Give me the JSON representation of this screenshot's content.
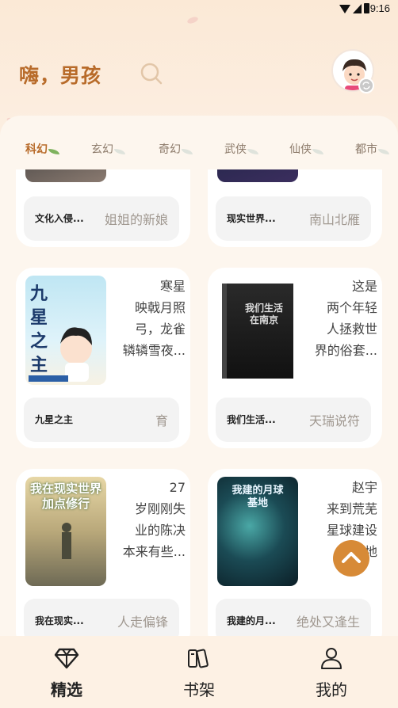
{
  "status": {
    "time": "9:16"
  },
  "header": {
    "greeting": "嗨，男孩"
  },
  "tabs": [
    {
      "label": "科幻",
      "active": true
    },
    {
      "label": "玄幻",
      "active": false
    },
    {
      "label": "奇幻",
      "active": false
    },
    {
      "label": "武侠",
      "active": false
    },
    {
      "label": "仙侠",
      "active": false
    },
    {
      "label": "都市",
      "active": false
    }
  ],
  "books": [
    {
      "title": "文化入侵...",
      "author": "姐姐的新娘",
      "desc": ""
    },
    {
      "title": "现实世界...",
      "author": "南山北雁",
      "desc": ""
    },
    {
      "title": "九星之主",
      "author": "育",
      "desc": "寒星\n映戟月照\n弓，龙雀\n辚辚雪夜...",
      "cover_text": "九星之主"
    },
    {
      "title": "我们生活...",
      "author": "天瑞说符",
      "desc": "这是\n两个年轻\n人拯救世\n界的俗套...",
      "cover_text": "我们生活在南京"
    },
    {
      "title": "我在现实...",
      "author": "人走偏锋",
      "desc": "27\n岁刚刚失\n业的陈决\n本来有些...",
      "cover_text": "我在现实世界加点修行"
    },
    {
      "title": "我建的月...",
      "author": "绝处又逢生",
      "desc": "赵宇\n来到荒芜\n星球建设\n基地",
      "cover_text": "我建的月球基地"
    }
  ],
  "bottom_nav": [
    {
      "label": "精选",
      "icon": "diamond-icon",
      "active": true
    },
    {
      "label": "书架",
      "icon": "bookshelf-icon",
      "active": false
    },
    {
      "label": "我的",
      "icon": "user-icon",
      "active": false
    }
  ],
  "colors": {
    "accent": "#b86b2a",
    "fab": "#d78a37",
    "background": "#fbeee0"
  }
}
